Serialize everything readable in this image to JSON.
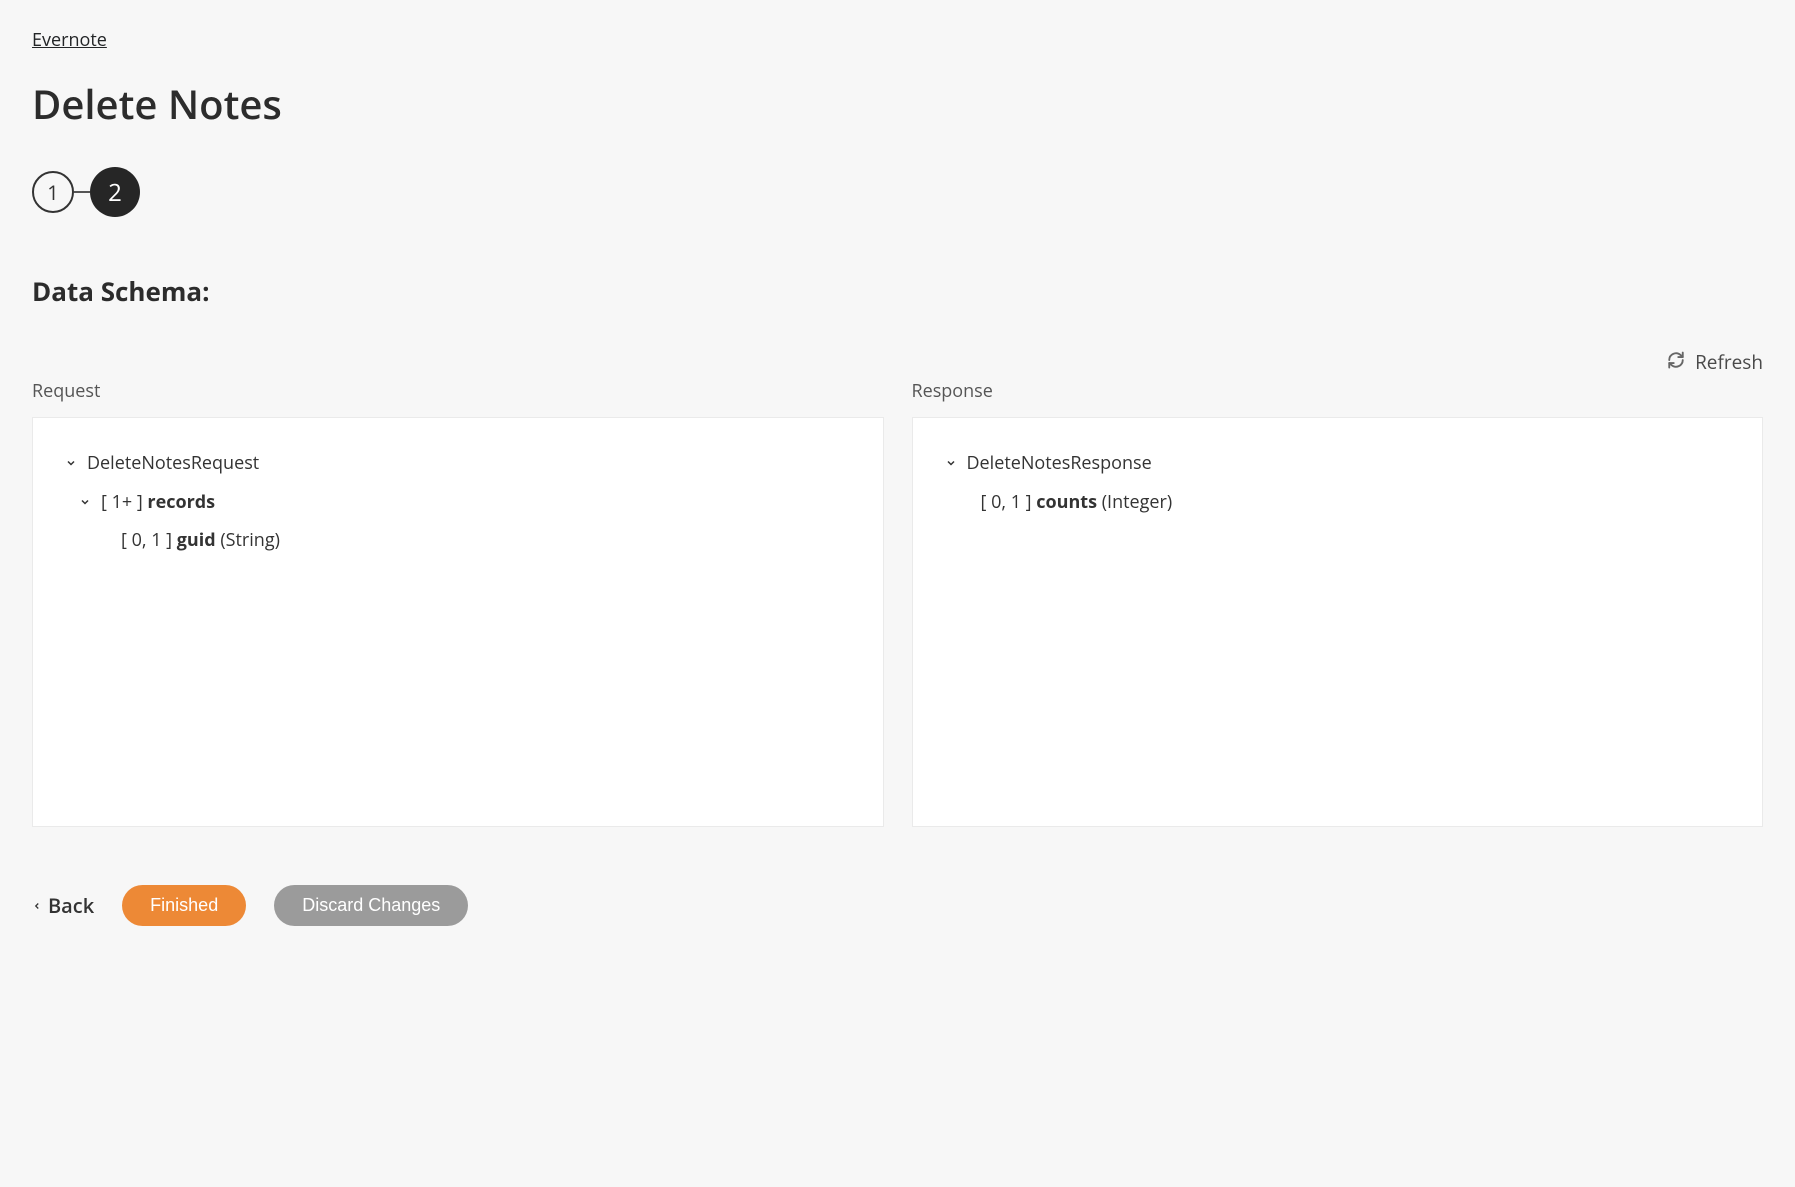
{
  "breadcrumb": {
    "label": "Evernote"
  },
  "page": {
    "title": "Delete Notes"
  },
  "stepper": {
    "step1": "1",
    "step2": "2",
    "active": 2
  },
  "section": {
    "title": "Data Schema:"
  },
  "refresh": {
    "label": "Refresh"
  },
  "request": {
    "label": "Request",
    "root": "DeleteNotesRequest",
    "records": {
      "cardinality": "[ 1+ ]",
      "name": "records"
    },
    "guid": {
      "cardinality": "[ 0, 1 ]",
      "name": "guid",
      "type": "(String)"
    }
  },
  "response": {
    "label": "Response",
    "root": "DeleteNotesResponse",
    "counts": {
      "cardinality": "[ 0, 1 ]",
      "name": "counts",
      "type": "(Integer)"
    }
  },
  "footer": {
    "back": "Back",
    "finished": "Finished",
    "discard": "Discard Changes"
  }
}
